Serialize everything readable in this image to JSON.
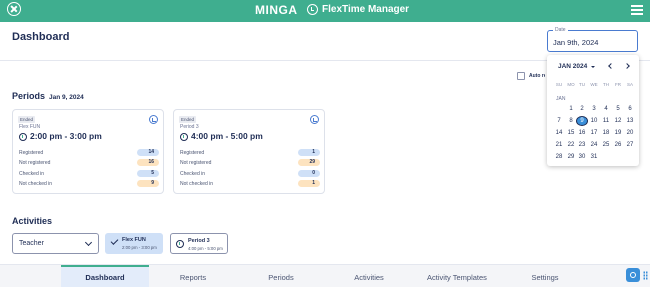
{
  "topbar": {
    "brand": "MINGA",
    "product": "FlexTime Manager"
  },
  "header": {
    "title": "Dashboard",
    "date_label": "Date",
    "date_value": "Jan 9th, 2024"
  },
  "auto_refresh": {
    "label": "Auto refresh",
    "checked": false
  },
  "periods": {
    "title": "Periods",
    "date": "Jan 9, 2024",
    "cards": [
      {
        "status": "Ended",
        "name": "Flex FUN",
        "time": "2:00 pm - 3:00 pm",
        "stats": [
          {
            "label": "Registered",
            "value": "14"
          },
          {
            "label": "Not registered",
            "value": "16"
          },
          {
            "label": "Checked in",
            "value": "5"
          },
          {
            "label": "Not checked in",
            "value": "9"
          }
        ]
      },
      {
        "status": "Ended",
        "name": "Period 3",
        "time": "4:00 pm - 5:00 pm",
        "stats": [
          {
            "label": "Registered",
            "value": "1"
          },
          {
            "label": "Not registered",
            "value": "29"
          },
          {
            "label": "Checked in",
            "value": "0"
          },
          {
            "label": "Not checked in",
            "value": "1"
          }
        ]
      }
    ]
  },
  "activities": {
    "title": "Activities",
    "filter_value": "Teacher",
    "chips": [
      {
        "name": "Flex FUN",
        "time": "2:00 pm - 3:00 pm",
        "selected": true
      },
      {
        "name": "Period 3",
        "time": "4:00 pm - 5:00 pm",
        "selected": false
      }
    ]
  },
  "bottom_nav": {
    "tabs": [
      "Dashboard",
      "Reports",
      "Periods",
      "Activities",
      "Activity Templates",
      "Settings"
    ],
    "active": "Dashboard"
  },
  "calendar": {
    "month_year": "JAN 2024",
    "month_label": "JAN",
    "weekdays": [
      "SU",
      "MO",
      "TU",
      "WE",
      "TH",
      "FR",
      "SA"
    ],
    "weeks": [
      [
        "",
        "1",
        "2",
        "3",
        "4",
        "5",
        "6"
      ],
      [
        "7",
        "8",
        "9",
        "10",
        "11",
        "12",
        "13"
      ],
      [
        "14",
        "15",
        "16",
        "17",
        "18",
        "19",
        "20"
      ],
      [
        "21",
        "22",
        "23",
        "24",
        "25",
        "26",
        "27"
      ],
      [
        "28",
        "29",
        "30",
        "31",
        "",
        "",
        ""
      ]
    ],
    "selected_day": "9"
  },
  "colors": {
    "brand_green": "#3fae8f",
    "primary_blue": "#3a8fd9",
    "navy": "#1f2d55",
    "pill_blue": "#cfe0f7",
    "pill_orange": "#fde3bf"
  }
}
